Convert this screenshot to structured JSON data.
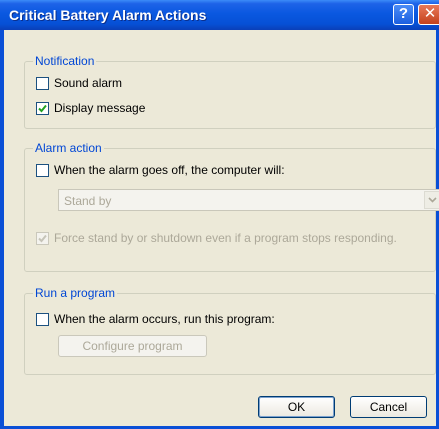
{
  "window": {
    "title": "Critical Battery Alarm Actions",
    "help_glyph": "?",
    "close_glyph": "✕"
  },
  "notification": {
    "label": "Notification",
    "sound_alarm": {
      "label": "Sound alarm",
      "checked": false
    },
    "display_message": {
      "label": "Display message",
      "checked": true
    }
  },
  "alarm_action": {
    "label": "Alarm action",
    "when_goes_off": {
      "label": "When the alarm goes off, the computer will:",
      "checked": false
    },
    "action_select": {
      "value": "Stand by",
      "enabled": false
    },
    "force_standby": {
      "label": "Force stand by or shutdown even if a program stops responding.",
      "checked": true,
      "enabled": false
    }
  },
  "run_program": {
    "label": "Run a program",
    "when_occurs": {
      "label": "When the alarm occurs, run this program:",
      "checked": false
    },
    "configure_label": "Configure program"
  },
  "footer": {
    "ok_label": "OK",
    "cancel_label": "Cancel"
  },
  "colors": {
    "title_bar": "#0a58e0",
    "group_label": "#0046d5",
    "dialog_bg": "#ece9d8",
    "checkmark": "#21a121"
  }
}
